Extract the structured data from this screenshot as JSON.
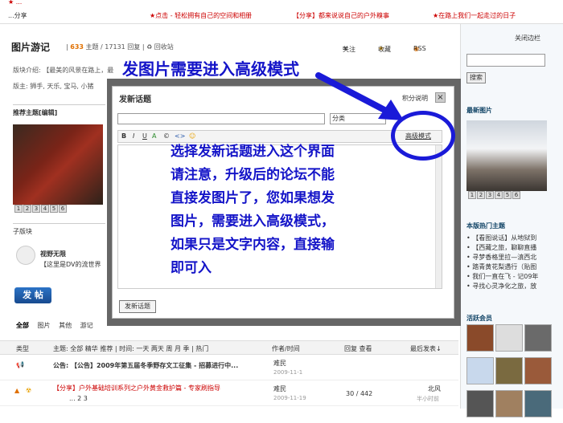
{
  "topbar": {
    "links": [
      {
        "text": "★ ...",
        "color": "#c00"
      },
      {
        "text": "★点击 - 轻松拥有自己的空间和相册",
        "color": "#c00"
      },
      {
        "text": "【分享】都来说说自己的户外糗事",
        "color": "#c00"
      },
      {
        "text": "★在路上我们一起走过的日子",
        "color": "#c00"
      },
      {
        "text": "...分享",
        "color": "#333"
      }
    ]
  },
  "forum": {
    "title": "图片游记",
    "topics_count": "633",
    "topics_label": "主题",
    "replies": "17131 回复",
    "recycle": "回收站",
    "follow": "关注",
    "favorite": "收藏",
    "rss": "RSS",
    "intro": "版块介绍: 【最美的风景在路上，最",
    "mods": "版主: 狮手, 天乐, 宝马, 小猪"
  },
  "left": {
    "recommend": "推荐主题[编辑]",
    "thumbs": [
      "1",
      "2",
      "3",
      "4",
      "5",
      "6"
    ],
    "subboard": "子版块",
    "sub_name": "视野无限",
    "sub_desc": "【这里是DV的流世界",
    "post_button": "发 帖"
  },
  "tabs": [
    "全部",
    "图片",
    "其他",
    "游记"
  ],
  "table": {
    "type_col": "类型",
    "filters": "主题: 全部  精华  推荐  | 时间: 一天  两天  周  月  季 | 热门",
    "author_col": "作者/时间",
    "reply_col": "回复 查看",
    "last_col": "最后发表↓",
    "rows": [
      {
        "title": "公告: 【公告】2009年第五届冬季野存文工征集 - 招募进行中...",
        "author": "难民",
        "date": "2009-11-1",
        "stats": "",
        "last": ""
      },
      {
        "title": "【分享】户外基础培训系列之户外黄金救护篇 - 专家刷指导",
        "pages": "... 2 3",
        "author": "难民",
        "date": "2009-11-19",
        "stats": "30 / 442",
        "last": "北风",
        "last_date": "半小时前"
      }
    ]
  },
  "sidebar": {
    "close": "关闭边栏",
    "search_btn": "搜索",
    "latest_photos": "最新图片",
    "photo_thumbs": [
      "1",
      "2",
      "3",
      "4",
      "5",
      "6"
    ],
    "hot_title": "本版热门主题",
    "hot_items": [
      "• 【看图说话】从地狱到",
      "• 【西藏之旅，聊聊直播",
      "• 寻梦香格里拉—滇西北",
      "• 踏青黄花梨遇行（贴图",
      "• 我们一直在飞 - 记09年",
      "• 寻找心灵净化之旅，放"
    ],
    "members_title": "活跃会员"
  },
  "dialog": {
    "title": "发新话题",
    "score": "积分说明",
    "close": "×",
    "category": "分类",
    "toolbar": [
      "B",
      "I",
      "U",
      "A",
      "©",
      "<>",
      "☺"
    ],
    "advanced": "高级模式",
    "submit": "发新话题"
  },
  "annotation": {
    "top": "发图片需要进入高级模式",
    "lines": [
      "选择发新话题进入这个界面",
      "请注意，升级后的论坛不能",
      "直接发图片了，您如果想发",
      "图片，需要进入高级模式，",
      "如果只是文字内容，直接输",
      "即可入"
    ]
  },
  "colors": {
    "annotation": "#1414c8",
    "accent": "#c00",
    "button": "#174a8f"
  }
}
